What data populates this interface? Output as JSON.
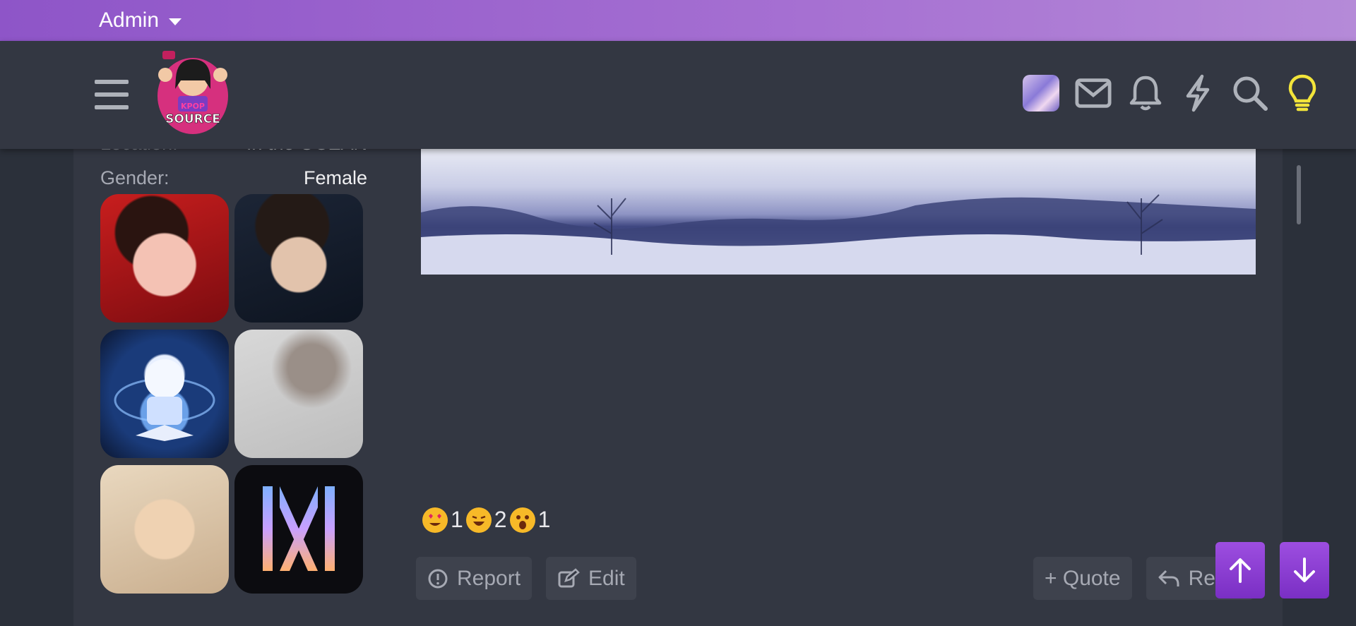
{
  "admin_bar": {
    "label": "Admin"
  },
  "header": {
    "logo_lines": [
      "KPOP",
      "SOURCE"
    ],
    "icons": [
      "menu-icon",
      "user-avatar",
      "envelope-icon",
      "bell-icon",
      "lightning-icon",
      "search-icon",
      "lightbulb-icon"
    ]
  },
  "profile": {
    "location_label": "Location:",
    "location_value": "In the OCEAN",
    "gender_label": "Gender:",
    "gender_value": "Female"
  },
  "reactions": [
    {
      "icon": "heart-eyes-emoji",
      "count": "1"
    },
    {
      "icon": "laughing-emoji",
      "count": "2"
    },
    {
      "icon": "shocked-emoji",
      "count": "1"
    }
  ],
  "actions": {
    "report": "Report",
    "edit": "Edit",
    "quote": "+ Quote",
    "reply": "Reply"
  },
  "colors": {
    "accent": "#9d4ee0",
    "admin_bar": "#a670d2",
    "background": "#2b303a",
    "panel": "#333742",
    "lightbulb": "#f2e43a"
  }
}
